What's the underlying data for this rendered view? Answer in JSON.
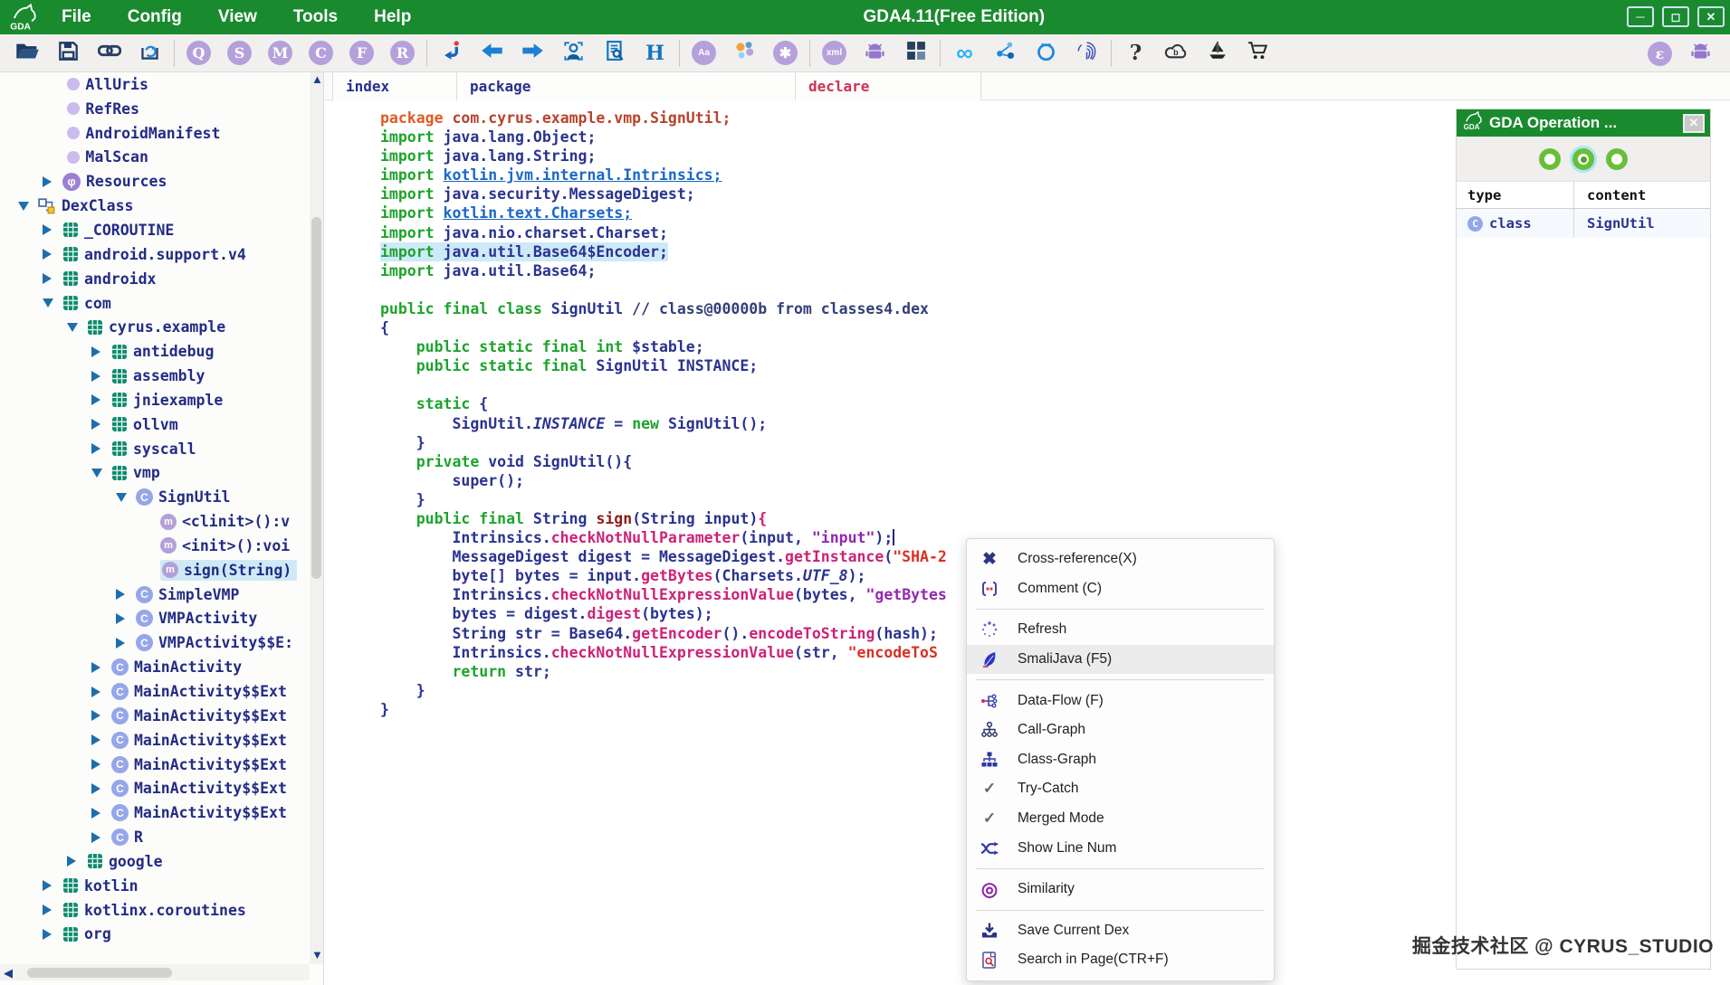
{
  "window": {
    "title": "GDA4.11(Free Edition)",
    "buttons": [
      {
        "name": "minimize-button",
        "glyph": "─"
      },
      {
        "name": "maximize-button",
        "glyph": "◻"
      },
      {
        "name": "close-button",
        "glyph": "✕"
      }
    ]
  },
  "menubar": {
    "items": [
      "File",
      "Config",
      "View",
      "Tools",
      "Help"
    ]
  },
  "toolbar": {
    "items": [
      {
        "name": "open-file-icon",
        "kind": "folder"
      },
      {
        "name": "save-icon",
        "kind": "save"
      },
      {
        "name": "link-icon",
        "kind": "link"
      },
      {
        "name": "reload-dex-icon",
        "kind": "sync"
      },
      {
        "sep": true
      },
      {
        "name": "query-search-icon",
        "badge": "Q"
      },
      {
        "name": "string-search-icon",
        "badge": "S"
      },
      {
        "name": "method-search-icon",
        "badge": "M"
      },
      {
        "name": "class-search-icon",
        "badge": "C"
      },
      {
        "name": "field-search-icon",
        "badge": "F"
      },
      {
        "name": "resource-search-icon",
        "badge": "R"
      },
      {
        "sep": true
      },
      {
        "name": "jump-icon",
        "kind": "jump"
      },
      {
        "name": "back-icon",
        "kind": "arrowL"
      },
      {
        "name": "forward-icon",
        "kind": "arrowR"
      },
      {
        "name": "privacy-scan-icon",
        "kind": "person"
      },
      {
        "name": "report-icon",
        "kind": "docsearch"
      },
      {
        "name": "hex-view-icon",
        "glyph": "H",
        "gcls": "g-H"
      },
      {
        "sep": true
      },
      {
        "name": "font-icon",
        "badge": "Aa",
        "small": true
      },
      {
        "name": "theme-colors-icon",
        "kind": "dots"
      },
      {
        "name": "settings-gear-icon",
        "badge": "✱"
      },
      {
        "sep": true
      },
      {
        "name": "xml-icon",
        "badge": "xml",
        "small": true
      },
      {
        "name": "apk-android-icon",
        "kind": "android"
      },
      {
        "name": "windows-icon",
        "kind": "windows"
      },
      {
        "sep": true
      },
      {
        "name": "infinity-icon",
        "glyph": "∞",
        "gcls": "g-inf"
      },
      {
        "name": "molecule-icon",
        "kind": "molecule"
      },
      {
        "name": "ring-icon",
        "kind": "ring"
      },
      {
        "name": "fingerprint-icon",
        "kind": "fingerprint"
      },
      {
        "sep": true
      },
      {
        "name": "help-icon",
        "glyph": "?",
        "gcls": "g-q"
      },
      {
        "name": "cloud-upload-icon",
        "kind": "cloud"
      },
      {
        "name": "sailboat-icon",
        "kind": "boat"
      },
      {
        "name": "cart-icon",
        "kind": "cart"
      }
    ],
    "right_items": [
      {
        "name": "epsilon-icon",
        "badge": "ε"
      },
      {
        "name": "android-icon",
        "kind": "android"
      }
    ]
  },
  "sidebar": {
    "tree": [
      {
        "label": "AllUris",
        "lvl": 1.2,
        "icon": "dot"
      },
      {
        "label": "RefRes",
        "lvl": 1.2,
        "icon": "dot"
      },
      {
        "label": "AndroidManifest",
        "lvl": 1.2,
        "icon": "dot"
      },
      {
        "label": "MalScan",
        "lvl": 1.2,
        "icon": "dot"
      },
      {
        "label": "Resources",
        "lvl": 1,
        "icon": "resources",
        "arrow": "r"
      },
      {
        "label": "DexClass",
        "lvl": 0,
        "icon": "dexclass",
        "arrow": "d"
      },
      {
        "label": "_COROUTINE",
        "lvl": 1,
        "icon": "package",
        "arrow": "r"
      },
      {
        "label": "android.support.v4",
        "lvl": 1,
        "icon": "package",
        "arrow": "r"
      },
      {
        "label": "androidx",
        "lvl": 1,
        "icon": "package",
        "arrow": "r"
      },
      {
        "label": "com",
        "lvl": 1,
        "icon": "package",
        "arrow": "d"
      },
      {
        "label": "cyrus.example",
        "lvl": 2,
        "icon": "package",
        "arrow": "d"
      },
      {
        "label": "antidebug",
        "lvl": 3,
        "icon": "package",
        "arrow": "r"
      },
      {
        "label": "assembly",
        "lvl": 3,
        "icon": "package",
        "arrow": "r"
      },
      {
        "label": "jniexample",
        "lvl": 3,
        "icon": "package",
        "arrow": "r"
      },
      {
        "label": "ollvm",
        "lvl": 3,
        "icon": "package",
        "arrow": "r"
      },
      {
        "label": "syscall",
        "lvl": 3,
        "icon": "package",
        "arrow": "r"
      },
      {
        "label": "vmp",
        "lvl": 3,
        "icon": "package",
        "arrow": "d"
      },
      {
        "label": "SignUtil",
        "lvl": 4,
        "icon": "class",
        "arrow": "d"
      },
      {
        "label": "<clinit>():v",
        "lvl": 5,
        "icon": "method"
      },
      {
        "label": "<init>():voi",
        "lvl": 5,
        "icon": "method"
      },
      {
        "label": "sign(String)",
        "lvl": 5,
        "icon": "method",
        "selected": true
      },
      {
        "label": "SimpleVMP",
        "lvl": 4,
        "icon": "class",
        "arrow": "r"
      },
      {
        "label": "VMPActivity",
        "lvl": 4,
        "icon": "class",
        "arrow": "r"
      },
      {
        "label": "VMPActivity$$E:",
        "lvl": 4,
        "icon": "class",
        "arrow": "r"
      },
      {
        "label": "MainActivity",
        "lvl": 3,
        "icon": "class",
        "arrow": "r"
      },
      {
        "label": "MainActivity$$Ext",
        "lvl": 3,
        "icon": "class",
        "arrow": "r"
      },
      {
        "label": "MainActivity$$Ext",
        "lvl": 3,
        "icon": "class",
        "arrow": "r"
      },
      {
        "label": "MainActivity$$Ext",
        "lvl": 3,
        "icon": "class",
        "arrow": "r"
      },
      {
        "label": "MainActivity$$Ext",
        "lvl": 3,
        "icon": "class",
        "arrow": "r"
      },
      {
        "label": "MainActivity$$Ext",
        "lvl": 3,
        "icon": "class",
        "arrow": "r"
      },
      {
        "label": "MainActivity$$Ext",
        "lvl": 3,
        "icon": "class",
        "arrow": "r"
      },
      {
        "label": "R",
        "lvl": 3,
        "icon": "class",
        "arrow": "r"
      },
      {
        "label": "google",
        "lvl": 2,
        "icon": "package",
        "arrow": "r"
      },
      {
        "label": "kotlin",
        "lvl": 1,
        "icon": "package",
        "arrow": "r"
      },
      {
        "label": "kotlinx.coroutines",
        "lvl": 1,
        "icon": "package",
        "arrow": "r"
      },
      {
        "label": "org",
        "lvl": 1,
        "icon": "package",
        "arrow": "r"
      }
    ]
  },
  "tabs": {
    "items": [
      {
        "label": "index"
      },
      {
        "label": "package"
      },
      {
        "label": "declare",
        "accent": true
      }
    ]
  },
  "code": {
    "lines": [
      {
        "seg": [
          [
            "PK",
            "package "
          ],
          [
            "PP",
            "com.cyrus.example.vmp.SignUtil;"
          ]
        ]
      },
      {
        "seg": [
          [
            "K",
            "import "
          ],
          [
            "N",
            "java.lang.Object;"
          ]
        ]
      },
      {
        "seg": [
          [
            "K",
            "import "
          ],
          [
            "N",
            "java.lang.String;"
          ]
        ]
      },
      {
        "seg": [
          [
            "K",
            "import "
          ],
          [
            "LN",
            "kotlin.jvm.internal.Intrinsics;"
          ]
        ]
      },
      {
        "seg": [
          [
            "K",
            "import "
          ],
          [
            "N",
            "java.security.MessageDigest;"
          ]
        ]
      },
      {
        "seg": [
          [
            "K",
            "import "
          ],
          [
            "LN",
            "kotlin.text.Charsets;"
          ]
        ]
      },
      {
        "seg": [
          [
            "K",
            "import "
          ],
          [
            "N",
            "java.nio.charset.Charset;"
          ]
        ]
      },
      {
        "hl": true,
        "seg": [
          [
            "K",
            "import "
          ],
          [
            "N",
            "java.util.Base64$Encoder;"
          ]
        ]
      },
      {
        "seg": [
          [
            "K",
            "import "
          ],
          [
            "N",
            "java.util.Base64;"
          ]
        ]
      },
      {
        "seg": []
      },
      {
        "seg": [
          [
            "K",
            "public final class "
          ],
          [
            "N",
            "SignUtil "
          ],
          [
            "CM",
            "// class@00000b from classes4.dex"
          ]
        ]
      },
      {
        "seg": [
          [
            "N",
            "{"
          ]
        ]
      },
      {
        "seg": [
          [
            "K",
            "    public static final int "
          ],
          [
            "N",
            "$stable;"
          ]
        ]
      },
      {
        "seg": [
          [
            "K",
            "    public static final "
          ],
          [
            "N",
            "SignUtil INSTANCE;"
          ]
        ]
      },
      {
        "seg": []
      },
      {
        "seg": [
          [
            "K",
            "    static "
          ],
          [
            "N",
            "{"
          ]
        ]
      },
      {
        "seg": [
          [
            "N",
            "        SignUtil."
          ],
          [
            "IT",
            "INSTANCE"
          ],
          [
            "N",
            " = "
          ],
          [
            "K",
            "new "
          ],
          [
            "N",
            "SignUtil();"
          ]
        ]
      },
      {
        "seg": [
          [
            "N",
            "    }"
          ]
        ]
      },
      {
        "seg": [
          [
            "K",
            "    private "
          ],
          [
            "N",
            "void SignUtil(){"
          ]
        ]
      },
      {
        "seg": [
          [
            "N",
            "        super();"
          ]
        ]
      },
      {
        "seg": [
          [
            "N",
            "    }"
          ]
        ]
      },
      {
        "seg": [
          [
            "K",
            "    public final "
          ],
          [
            "N",
            "String "
          ],
          [
            "MN",
            "sign"
          ],
          [
            "N",
            "(String input)"
          ],
          [
            "MG",
            "{"
          ]
        ]
      },
      {
        "seg": [
          [
            "N",
            "        Intrinsics."
          ],
          [
            "M",
            "checkNotNullParameter"
          ],
          [
            "N",
            "(input, "
          ],
          [
            "S1",
            "\"input\""
          ],
          [
            "N",
            ");"
          ],
          [
            "CUR",
            ""
          ]
        ]
      },
      {
        "seg": [
          [
            "N",
            "        MessageDigest digest = MessageDigest."
          ],
          [
            "M",
            "getInstance"
          ],
          [
            "N",
            "("
          ],
          [
            "S2",
            "\"SHA-2"
          ]
        ]
      },
      {
        "seg": [
          [
            "N",
            "        byte[] bytes = input."
          ],
          [
            "M",
            "getBytes"
          ],
          [
            "N",
            "(Charsets."
          ],
          [
            "IT",
            "UTF_8"
          ],
          [
            "N",
            ");"
          ]
        ]
      },
      {
        "seg": [
          [
            "N",
            "        Intrinsics."
          ],
          [
            "M",
            "checkNotNullExpressionValue"
          ],
          [
            "N",
            "(bytes, "
          ],
          [
            "S1",
            "\"getBytes"
          ]
        ]
      },
      {
        "seg": [
          [
            "N",
            "        bytes = digest."
          ],
          [
            "M",
            "digest"
          ],
          [
            "N",
            "(bytes);"
          ]
        ]
      },
      {
        "seg": [
          [
            "N",
            "        String str = Base64."
          ],
          [
            "M",
            "getEncoder"
          ],
          [
            "N",
            "()."
          ],
          [
            "M",
            "encodeToString"
          ],
          [
            "N",
            "(hash);"
          ]
        ]
      },
      {
        "seg": [
          [
            "N",
            "        Intrinsics."
          ],
          [
            "M",
            "checkNotNullExpressionValue"
          ],
          [
            "N",
            "(str, "
          ],
          [
            "S2",
            "\"encodeToS"
          ]
        ]
      },
      {
        "seg": [
          [
            "K",
            "        return "
          ],
          [
            "N",
            "str;"
          ]
        ]
      },
      {
        "seg": [
          [
            "N",
            "    }"
          ]
        ]
      },
      {
        "seg": [
          [
            "N",
            "}"
          ]
        ]
      }
    ]
  },
  "context_menu": {
    "items": [
      {
        "icon": "xref-icon",
        "label": "Cross-reference(X)"
      },
      {
        "icon": "comment-icon",
        "label": "Comment (C)"
      },
      {
        "sep": true
      },
      {
        "icon": "refresh-icon",
        "label": "Refresh"
      },
      {
        "icon": "feather-icon",
        "label": "SmaliJava (F5)",
        "highlighted": true
      },
      {
        "sep": true
      },
      {
        "icon": "dataflow-icon",
        "label": "Data-Flow (F)"
      },
      {
        "icon": "callgraph-icon",
        "label": "Call-Graph"
      },
      {
        "icon": "classgraph-icon",
        "label": "Class-Graph"
      },
      {
        "icon": "check-icon",
        "label": "Try-Catch"
      },
      {
        "icon": "check-icon",
        "label": "Merged Mode"
      },
      {
        "icon": "shuffle-icon",
        "label": "Show Line Num"
      },
      {
        "sep": true
      },
      {
        "icon": "similarity-icon",
        "label": "Similarity"
      },
      {
        "sep": true
      },
      {
        "icon": "savedex-icon",
        "label": "Save Current Dex"
      },
      {
        "icon": "searchpage-icon",
        "label": "Search in Page(CTR+F)"
      }
    ]
  },
  "operation_panel": {
    "title": "GDA Operation ...",
    "close_glyph": "✕",
    "columns": [
      "type",
      "content"
    ],
    "rows": [
      {
        "type_label": "class",
        "content": "SignUtil"
      }
    ]
  },
  "watermark": {
    "text": "掘金技术社区 @ CYRUS_STUDIO"
  }
}
